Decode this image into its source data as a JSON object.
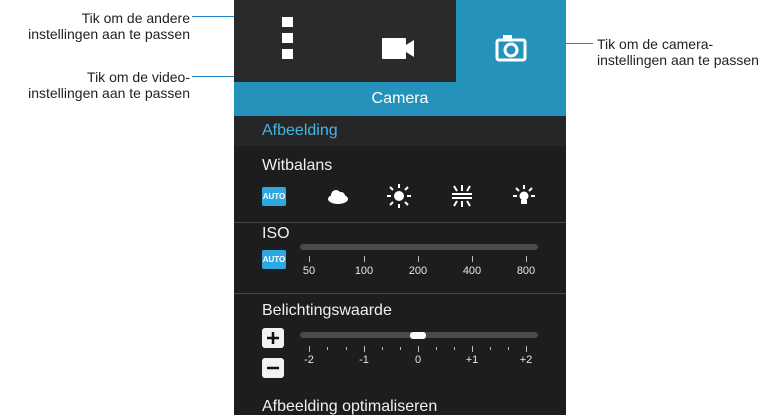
{
  "callouts": {
    "more_settings": "Tik om de andere instellingen aan te passen",
    "more_settings_lines": [
      "Tik om de andere",
      "instellingen aan te passen"
    ],
    "video_settings_lines": [
      "Tik om de video-",
      "instellingen aan te passen"
    ],
    "camera_settings_lines": [
      "Tik om de camera-",
      "instellingen aan te passen"
    ]
  },
  "tabs": [
    {
      "name": "menu",
      "icon": "vertical-dots-icon",
      "selected": false
    },
    {
      "name": "video",
      "icon": "video-camera-icon",
      "selected": false
    },
    {
      "name": "camera",
      "icon": "camera-icon",
      "selected": true
    }
  ],
  "title": "Camera",
  "section": "Afbeelding",
  "white_balance": {
    "label": "Witbalans",
    "auto": "AUTO",
    "options": [
      "cloud-icon",
      "sun-icon",
      "fluorescent-icon",
      "incandescent-icon"
    ]
  },
  "iso": {
    "label": "ISO",
    "auto": "AUTO",
    "values": [
      "50",
      "100",
      "200",
      "400",
      "800"
    ]
  },
  "exposure": {
    "label": "Belichtingswaarde",
    "values": [
      "-2",
      "-1",
      "0",
      "+1",
      "+2"
    ],
    "current": 0
  },
  "next_item": "Afbeelding optimaliseren",
  "colors": {
    "accent": "#2492ba",
    "section_text": "#45b5e6",
    "callout_line": "#1e88c8"
  }
}
